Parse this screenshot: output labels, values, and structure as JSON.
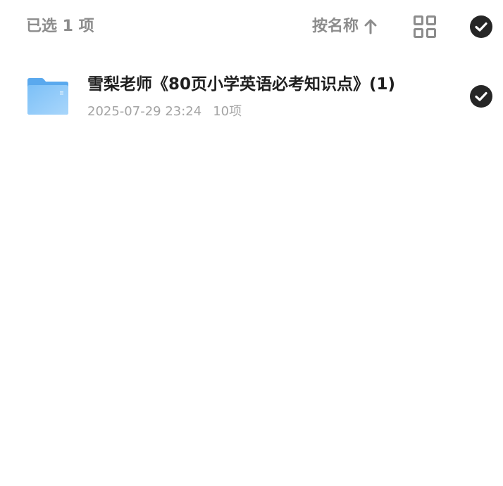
{
  "header": {
    "selected_count": "已选 1 项",
    "sort_label": "按名称",
    "sort_arrow_icon": "arrow-up-icon",
    "view_toggle_icon": "grid-view-icon",
    "select_all_icon": "check-circle-icon"
  },
  "files": [
    {
      "icon": "folder-icon",
      "name": "雪梨老师《80页小学英语必考知识点》(1)",
      "modified": "2025-07-29 23:24",
      "item_count": "10项",
      "selected": true,
      "check_icon": "check-circle-icon"
    }
  ],
  "colors": {
    "header_text": "#8c8c8c",
    "file_name": "#1f1f1f",
    "meta_text": "#a3a3a3",
    "check_fill": "#262626",
    "folder_blue": "#6fb7f5",
    "folder_blue_light": "#a6d4fb"
  }
}
